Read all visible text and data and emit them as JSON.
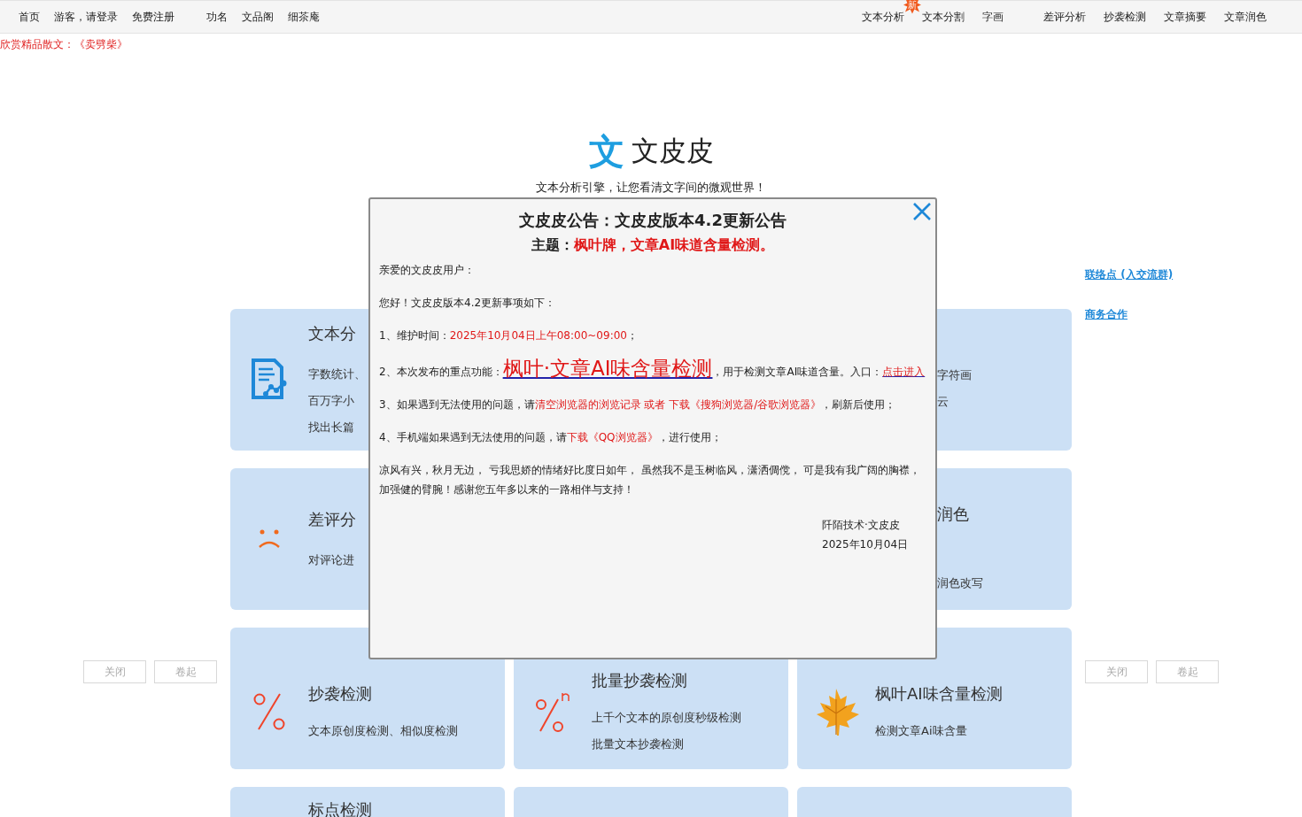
{
  "nav": {
    "left": [
      {
        "label": "首页"
      },
      {
        "label": "游客，请登录"
      },
      {
        "label": "免费注册"
      },
      {
        "label": "功名"
      },
      {
        "label": "文品阁"
      },
      {
        "label": "细茶庵"
      }
    ],
    "right": [
      {
        "label": "文本分析",
        "badge": "新"
      },
      {
        "label": "文本分割"
      },
      {
        "label": "字画"
      },
      {
        "label": "差评分析"
      },
      {
        "label": "抄袭检测"
      },
      {
        "label": "文章摘要"
      },
      {
        "label": "文章润色"
      }
    ]
  },
  "notice": "欣赏精品散文：《卖劈柴》",
  "logo": {
    "mark": "文",
    "name": "文皮皮"
  },
  "tagline": "文本分析引擎，让您看清文字间的微观世界！",
  "side_links": [
    "联络点 (入交流群)",
    "商务合作"
  ],
  "card_rows": [
    {
      "cards": [
        {
          "kind": "left_part",
          "title": "文本分",
          "lines": [
            "字数统计、",
            "百万字小",
            "找出长篇"
          ]
        },
        {
          "kind": "right_part",
          "lines": [
            "字符画",
            "云"
          ]
        }
      ]
    },
    {
      "cards": [
        {
          "kind": "left_part",
          "title": "差评分",
          "lines": [
            "对评论进"
          ]
        },
        {
          "kind": "right_part",
          "title": "润色",
          "lines": [
            "润色改写"
          ]
        }
      ]
    },
    {
      "cards": [
        {
          "kind": "whole",
          "title": "抄袭检测",
          "lines": [
            "文本原创度检测、相似度检测"
          ]
        },
        {
          "kind": "whole",
          "title": "批量抄袭检测",
          "lines": [
            "上千个文本的原创度秒级检测",
            "批量文本抄袭检测"
          ]
        },
        {
          "kind": "whole",
          "title": "枫叶AI味含量检测",
          "lines": [
            "检测文章Ai味含量"
          ]
        }
      ]
    },
    {
      "cards": [
        {
          "kind": "cut_bottom",
          "title": "标点检测"
        },
        {
          "kind": "cut_bottom"
        },
        {
          "kind": "cut_bottom"
        }
      ]
    }
  ],
  "float_buttons": {
    "left": [
      "关闭",
      "卷起"
    ],
    "right": [
      "关闭",
      "卷起"
    ]
  },
  "dialog": {
    "title": "文皮皮公告：文皮皮版本4.2更新公告",
    "subject_label": "主题：",
    "subject": "枫叶牌，文章AI味道含量检测。",
    "paragraphs": [
      [
        {
          "kind": "plain",
          "text": "亲爱的文皮皮用户："
        }
      ],
      [
        {
          "kind": "plain",
          "text": "您好！文皮皮版本4.2更新事项如下："
        }
      ],
      [
        {
          "kind": "plain",
          "text": "1、维护时间："
        },
        {
          "kind": "red",
          "text": "2025年10月04日上午08:00~09:00"
        },
        {
          "kind": "plain",
          "text": "；"
        }
      ],
      [
        {
          "kind": "plain",
          "text": "2、本次发布的重点功能："
        },
        {
          "kind": "big_link",
          "text": "枫叶·文章AI味含量检测"
        },
        {
          "kind": "plain",
          "text": "，用于检测文章AI味道含量。入口："
        },
        {
          "kind": "link",
          "text": "点击进入"
        }
      ],
      [
        {
          "kind": "plain",
          "text": "3、如果遇到无法使用的问题，请"
        },
        {
          "kind": "red",
          "text": "清空浏览器的浏览记录 或者 下载《搜狗浏览器/谷歌浏览器》"
        },
        {
          "kind": "plain",
          "text": "，刷新后使用；"
        }
      ],
      [
        {
          "kind": "plain",
          "text": "4、手机端如果遇到无法使用的问题，请"
        },
        {
          "kind": "red",
          "text": "下载《QQ浏览器》"
        },
        {
          "kind": "plain",
          "text": "，进行使用；"
        }
      ],
      [
        {
          "kind": "plain",
          "text": "凉风有兴，秋月无边， 亏我思娇的情绪好比度日如年， 虽然我不是玉树临风，潇洒倜傥， 可是我有我广阔的胸襟，加强健的臂腕！感谢您五年多以来的一路相伴与支持！"
        }
      ]
    ],
    "signature": "阡陌技术·文皮皮",
    "date": "2025年10月04日"
  }
}
